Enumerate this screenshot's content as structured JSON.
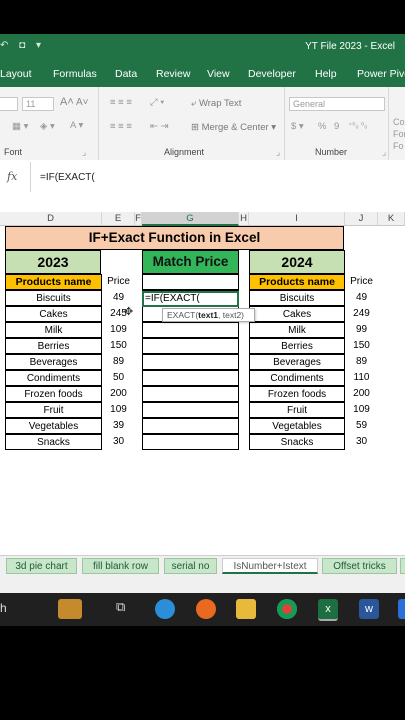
{
  "window": {
    "title": "YT File 2023  -  Excel"
  },
  "menu": [
    "Layout",
    "Formulas",
    "Data",
    "Review",
    "View",
    "Developer",
    "Help",
    "Power Pivot"
  ],
  "ribbon": {
    "font_size": "11",
    "wrap_text": "Wrap Text",
    "merge_center": "Merge & Center",
    "number_format": "General",
    "currency": "$",
    "percent": "%",
    "comma": "9",
    "groups": {
      "font": "Font",
      "alignment": "Alignment",
      "number": "Number"
    },
    "cond_1": "Co",
    "cond_2": "For",
    "cond_3": "Fo"
  },
  "formula_bar": {
    "fx": "fx",
    "formula": "=IF(EXACT("
  },
  "columns": [
    "D",
    "E",
    "F",
    "G",
    "H",
    "I",
    "J",
    "K"
  ],
  "sheet": {
    "banner": "IF+Exact Function in Excel",
    "left_year": "2023",
    "match_header": "Match Price",
    "right_year": "2024",
    "product_header": "Products name",
    "price_header": "Price",
    "editing_cell": "=IF(EXACT(",
    "tooltip_fn": "EXACT(",
    "tooltip_arg1": "text1",
    "tooltip_rest": ", text2)",
    "left_rows": [
      {
        "name": "Biscuits",
        "price": "49"
      },
      {
        "name": "Cakes",
        "price": "245"
      },
      {
        "name": "Milk",
        "price": "109"
      },
      {
        "name": "Berries",
        "price": "150"
      },
      {
        "name": "Beverages",
        "price": "89"
      },
      {
        "name": "Condiments",
        "price": "50"
      },
      {
        "name": "Frozen foods",
        "price": "200"
      },
      {
        "name": "Fruit",
        "price": "109"
      },
      {
        "name": "Vegetables",
        "price": "39"
      },
      {
        "name": "Snacks",
        "price": "30"
      }
    ],
    "right_rows": [
      {
        "name": "Biscuits",
        "price": "49"
      },
      {
        "name": "Cakes",
        "price": "249"
      },
      {
        "name": "Milk",
        "price": "99"
      },
      {
        "name": "Berries",
        "price": "150"
      },
      {
        "name": "Beverages",
        "price": "89"
      },
      {
        "name": "Condiments",
        "price": "110"
      },
      {
        "name": "Frozen foods",
        "price": "200"
      },
      {
        "name": "Fruit",
        "price": "109"
      },
      {
        "name": "Vegetables",
        "price": "59"
      },
      {
        "name": "Snacks",
        "price": "30"
      }
    ]
  },
  "tabs": [
    "3d pie chart",
    "fill blank row",
    "serial no",
    "IsNumber+Istext",
    "Offset tricks"
  ],
  "active_tab": "IsNumber+Istext",
  "taskbar": {
    "search_fragment": "h"
  },
  "colors": {
    "excel_green": "#217346",
    "banner": "#f8cbad",
    "year_header": "#c6e0b4",
    "match_header": "#33b55a",
    "product_header": "#ffc000"
  }
}
